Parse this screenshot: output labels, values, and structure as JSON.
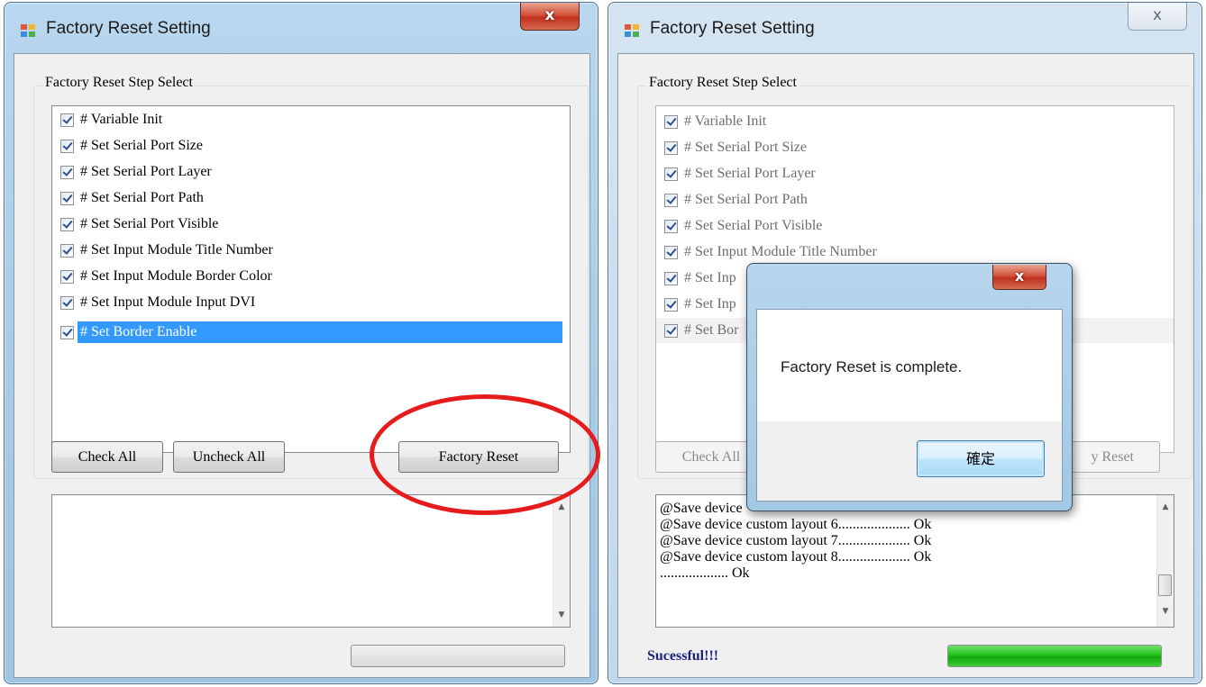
{
  "window_left": {
    "title": "Factory Reset Setting",
    "close_glyph": "x",
    "group_label": "Factory Reset Step Select",
    "items": [
      {
        "label": "# Variable Init",
        "checked": true
      },
      {
        "label": "# Set Serial Port Size",
        "checked": true
      },
      {
        "label": "# Set Serial Port Layer",
        "checked": true
      },
      {
        "label": "# Set Serial Port Path",
        "checked": true
      },
      {
        "label": "# Set Serial Port Visible",
        "checked": true
      },
      {
        "label": "# Set Input Module Title Number",
        "checked": true
      },
      {
        "label": "# Set Input Module Border Color",
        "checked": true
      },
      {
        "label": "# Set Input Module Input DVI",
        "checked": true
      },
      {
        "label": "# Set Border Enable",
        "checked": true,
        "selected": true
      }
    ],
    "buttons": {
      "check_all": "Check All",
      "uncheck_all": "Uncheck All",
      "factory_reset": "Factory Reset"
    },
    "progress": 0
  },
  "window_right": {
    "title": "Factory Reset Setting",
    "close_glyph": "x",
    "group_label": "Factory Reset Step Select",
    "items": [
      {
        "label": "# Variable Init"
      },
      {
        "label": "# Set Serial Port Size"
      },
      {
        "label": "# Set Serial Port Layer"
      },
      {
        "label": "# Set Serial Port Path"
      },
      {
        "label": "# Set Serial Port Visible"
      },
      {
        "label": "# Set Input Module Title Number"
      },
      {
        "label": "# Set Inp"
      },
      {
        "label": "# Set Inp"
      },
      {
        "label": "# Set Bor"
      }
    ],
    "buttons": {
      "check_all": "Check All",
      "factory_reset_partial": "y Reset"
    },
    "log_lines": [
      "@Save device",
      "@Save device custom layout 6.................... Ok",
      "@Save device custom layout 7.................... Ok",
      "@Save device custom layout 8.................... Ok",
      "................... Ok"
    ],
    "status": "Sucessful!!!",
    "progress": 1.0
  },
  "dialog": {
    "close_glyph": "x",
    "message": "Factory Reset is complete.",
    "ok_label": "確定"
  },
  "colors": {
    "selection": "#3399ff",
    "close_active": "#c8402a",
    "progress_fill": "#21c21a",
    "annotation": "#e61b1b",
    "status_text": "#1a237e"
  }
}
